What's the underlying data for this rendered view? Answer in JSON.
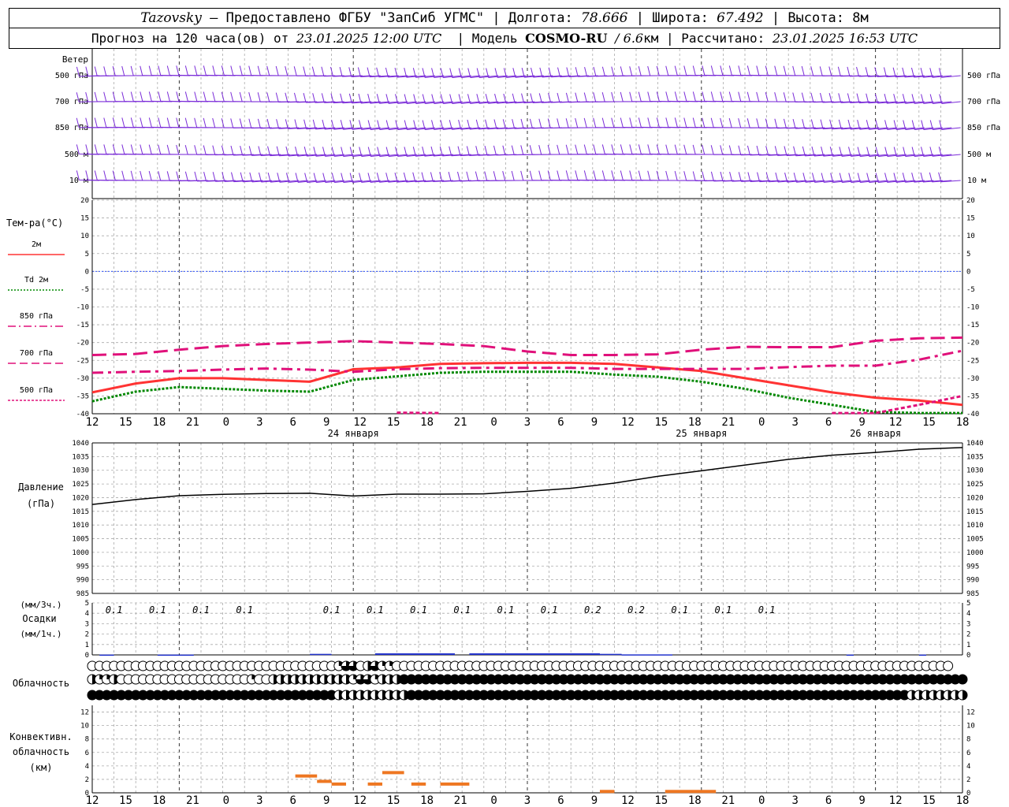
{
  "header": {
    "station": "Tazovsky",
    "provider": "— Предоставлено ФГБУ \"ЗапСиб УГМС\"",
    "lon_label": "Долгота:",
    "lon": "78.666",
    "lat_label": "Широта:",
    "lat": "67.492",
    "alt_label": "Высота:",
    "alt": "8м",
    "fc_label": "Прогноз на 120 часа(ов) от",
    "fc_start": "23.01.2025 12:00 UTC",
    "model_label": "Модель",
    "model": "COSMO-RU",
    "model_res": "/ 6.6",
    "model_res_unit": "км",
    "calc_label": "Рассчитано:",
    "calc_time": "23.01.2025 16:53 UTC"
  },
  "wind_panel": {
    "title": "Ветер",
    "levels": [
      "500 гПа",
      "700 гПа",
      "850 гПа",
      "500 м",
      "10  м"
    ]
  },
  "temp_panel": {
    "title": "Тем-ра(°C)",
    "legend": [
      {
        "label": "2м",
        "color": "#ff3333",
        "style": "solid"
      },
      {
        "label": "Td  2м",
        "color": "#008800",
        "style": "dotted"
      },
      {
        "label": "850 гПа",
        "color": "#e0107a",
        "style": "dashdot"
      },
      {
        "label": "700 гПа",
        "color": "#e0107a",
        "style": "dash"
      },
      {
        "label": "500 гПа",
        "color": "#e0107a",
        "style": "dot"
      }
    ]
  },
  "pressure_panel": {
    "title": "Давление",
    "unit": "(гПа)"
  },
  "precip_panel": {
    "title_top": "(мм/3ч.)",
    "title": "Осадки",
    "title_bottom": "(мм/1ч.)"
  },
  "cloud_panel": {
    "title": "Облачность"
  },
  "conv_panel": {
    "title_1": "Конвективн.",
    "title_2": "облачность",
    "title_3": "(км)"
  },
  "time_axis": {
    "hour_labels": [
      "12",
      "15",
      "18",
      "21",
      "0",
      "3",
      "6",
      "9",
      "12",
      "15",
      "18",
      "21",
      "0",
      "3",
      "6",
      "9",
      "12",
      "15",
      "18",
      "21",
      "0",
      "3",
      "6",
      "9",
      "12",
      "15",
      "18"
    ],
    "day_labels": [
      "24 января",
      "25 января",
      "26 января"
    ]
  },
  "chart_data": [
    {
      "type": "line",
      "title": "Тем-ра(°C)",
      "x_hours": [
        0,
        6,
        12,
        18,
        24,
        30,
        36,
        42,
        48,
        54,
        60,
        66,
        72,
        78,
        84,
        90,
        96,
        102,
        108,
        114,
        120
      ],
      "ylim": [
        -40,
        20
      ],
      "series": [
        {
          "name": "2м",
          "color": "#ff3333",
          "values": [
            -34,
            -31.5,
            -30,
            -30,
            -30.5,
            -31,
            -27.5,
            -27,
            -26,
            -25.8,
            -25.7,
            -25.7,
            -26,
            -27,
            -28,
            -30,
            -32,
            -34,
            -35.5,
            -36.3,
            -37.5
          ]
        },
        {
          "name": "Td  2м",
          "color": "#008800",
          "values": [
            -36.5,
            -33.8,
            -32.5,
            -33,
            -33.5,
            -33.8,
            -30.5,
            -29.5,
            -28.5,
            -28.2,
            -28.2,
            -28.2,
            -29,
            -29.6,
            -31,
            -33,
            -35.5,
            -37.5,
            -39.5,
            -40,
            -41
          ]
        },
        {
          "name": "850 гПа",
          "color": "#e0107a",
          "values": [
            -28.5,
            -28.2,
            -28,
            -27.6,
            -27.3,
            -27.6,
            -28.2,
            -27.5,
            -27.2,
            -27.1,
            -27.1,
            -27.1,
            -27.4,
            -27.4,
            -27.4,
            -27.4,
            -26.9,
            -26.5,
            -26.5,
            -24.8,
            -22.3
          ]
        },
        {
          "name": "700 гПа",
          "color": "#e0107a",
          "values": [
            -23.5,
            -23.2,
            -22,
            -21,
            -20.4,
            -20,
            -19.6,
            -20,
            -20.4,
            -21,
            -22.5,
            -23.5,
            -23.5,
            -23.3,
            -22,
            -21.2,
            -21.3,
            -21.3,
            -19.5,
            -18.8,
            -18.6
          ]
        },
        {
          "name": "500 гПа",
          "color": "#e0107a",
          "values": [
            null,
            null,
            null,
            null,
            null,
            null,
            null,
            -39.7,
            -39.9,
            null,
            null,
            null,
            null,
            null,
            null,
            null,
            null,
            -40.5,
            -39.8,
            -37.5,
            -35
          ]
        }
      ]
    },
    {
      "type": "line",
      "title": "Давление",
      "x_hours": [
        0,
        6,
        12,
        18,
        24,
        30,
        36,
        42,
        48,
        54,
        60,
        66,
        72,
        78,
        84,
        90,
        96,
        102,
        108,
        114,
        120
      ],
      "ylim": [
        985,
        1040
      ],
      "series": [
        {
          "name": "Давление",
          "values": [
            1017.5,
            1019.3,
            1020.7,
            1021.2,
            1021.5,
            1021.6,
            1020.6,
            1021.3,
            1021.3,
            1021.4,
            1022.3,
            1023.4,
            1025.3,
            1027.8,
            1029.8,
            1031.9,
            1034,
            1035.5,
            1036.5,
            1037.7,
            1038.3
          ]
        }
      ]
    },
    {
      "type": "bar",
      "title": "Осадки",
      "ylim": [
        0,
        5
      ],
      "x_hours_3h": [
        3,
        9,
        15,
        21,
        33,
        39,
        45,
        51,
        57,
        63,
        69,
        75,
        81,
        87,
        93
      ],
      "labels_3h": [
        "0.1",
        "0.1",
        "0.1",
        "0.1",
        "0.1",
        "0.1",
        "0.1",
        "0.1",
        "0.1",
        "0.1",
        "0.2",
        "0.2",
        "0.1",
        "0.1",
        "0.1"
      ],
      "hourly_bars": [
        [
          1,
          3,
          0.03
        ],
        [
          9,
          14,
          0.03
        ],
        [
          30,
          33,
          0.1
        ],
        [
          39,
          50,
          0.15
        ],
        [
          52,
          70,
          0.15
        ],
        [
          70,
          73,
          0.1
        ],
        [
          73,
          80,
          0.05
        ],
        [
          104,
          105,
          0.03
        ],
        [
          114,
          115,
          0.03
        ]
      ]
    },
    {
      "type": "table",
      "title": "Облачность",
      "rows": [
        "OOOOOOOOOOOOOOOOOOOOOOOOOOOOOOOOOOQTTBHTQQOOOOOOOOOOOOOOOOOOOOOOOOOOOOOOOOOOOOOOOOOOOOOOOOOOOOOOOOOOOOOOOOOOOOOOOOOOOOO",
        "HQQHOOOOOOOOOOOOOOOOOOQOOHHHHHHHHHHHQTTQHHHFFFFFFFFFFFFFFFFFFFFFFFFFFFFFFFFFFFFFFFFFFFFFFFFFFFFFFFFFFFFFFFFFFFFFFFFFFFFFF",
        "FFFFFFFFFFFFFFFFFFFFFFFFFFFFFFFFFFHHHHHHHHHHFFFFFFFFFFFFFFFFFFFFFFFFFFFFFFFFFFFFFFFFFFFFFFFFFFFFFFFFFFFFFFFFFFFFFHHHHHHHH"
      ]
    },
    {
      "type": "bar",
      "title": "Конвективн. облачность",
      "ylim": [
        0,
        13
      ],
      "segments": [
        [
          28,
          31,
          2.5
        ],
        [
          31,
          33,
          1.7
        ],
        [
          33,
          35,
          1.3
        ],
        [
          38,
          40,
          1.3
        ],
        [
          40,
          43,
          3.0
        ],
        [
          44,
          46,
          1.3
        ],
        [
          48,
          50,
          1.3
        ],
        [
          50,
          52,
          1.3
        ],
        [
          70,
          72,
          0.2
        ],
        [
          79,
          86,
          0.2
        ]
      ]
    }
  ]
}
